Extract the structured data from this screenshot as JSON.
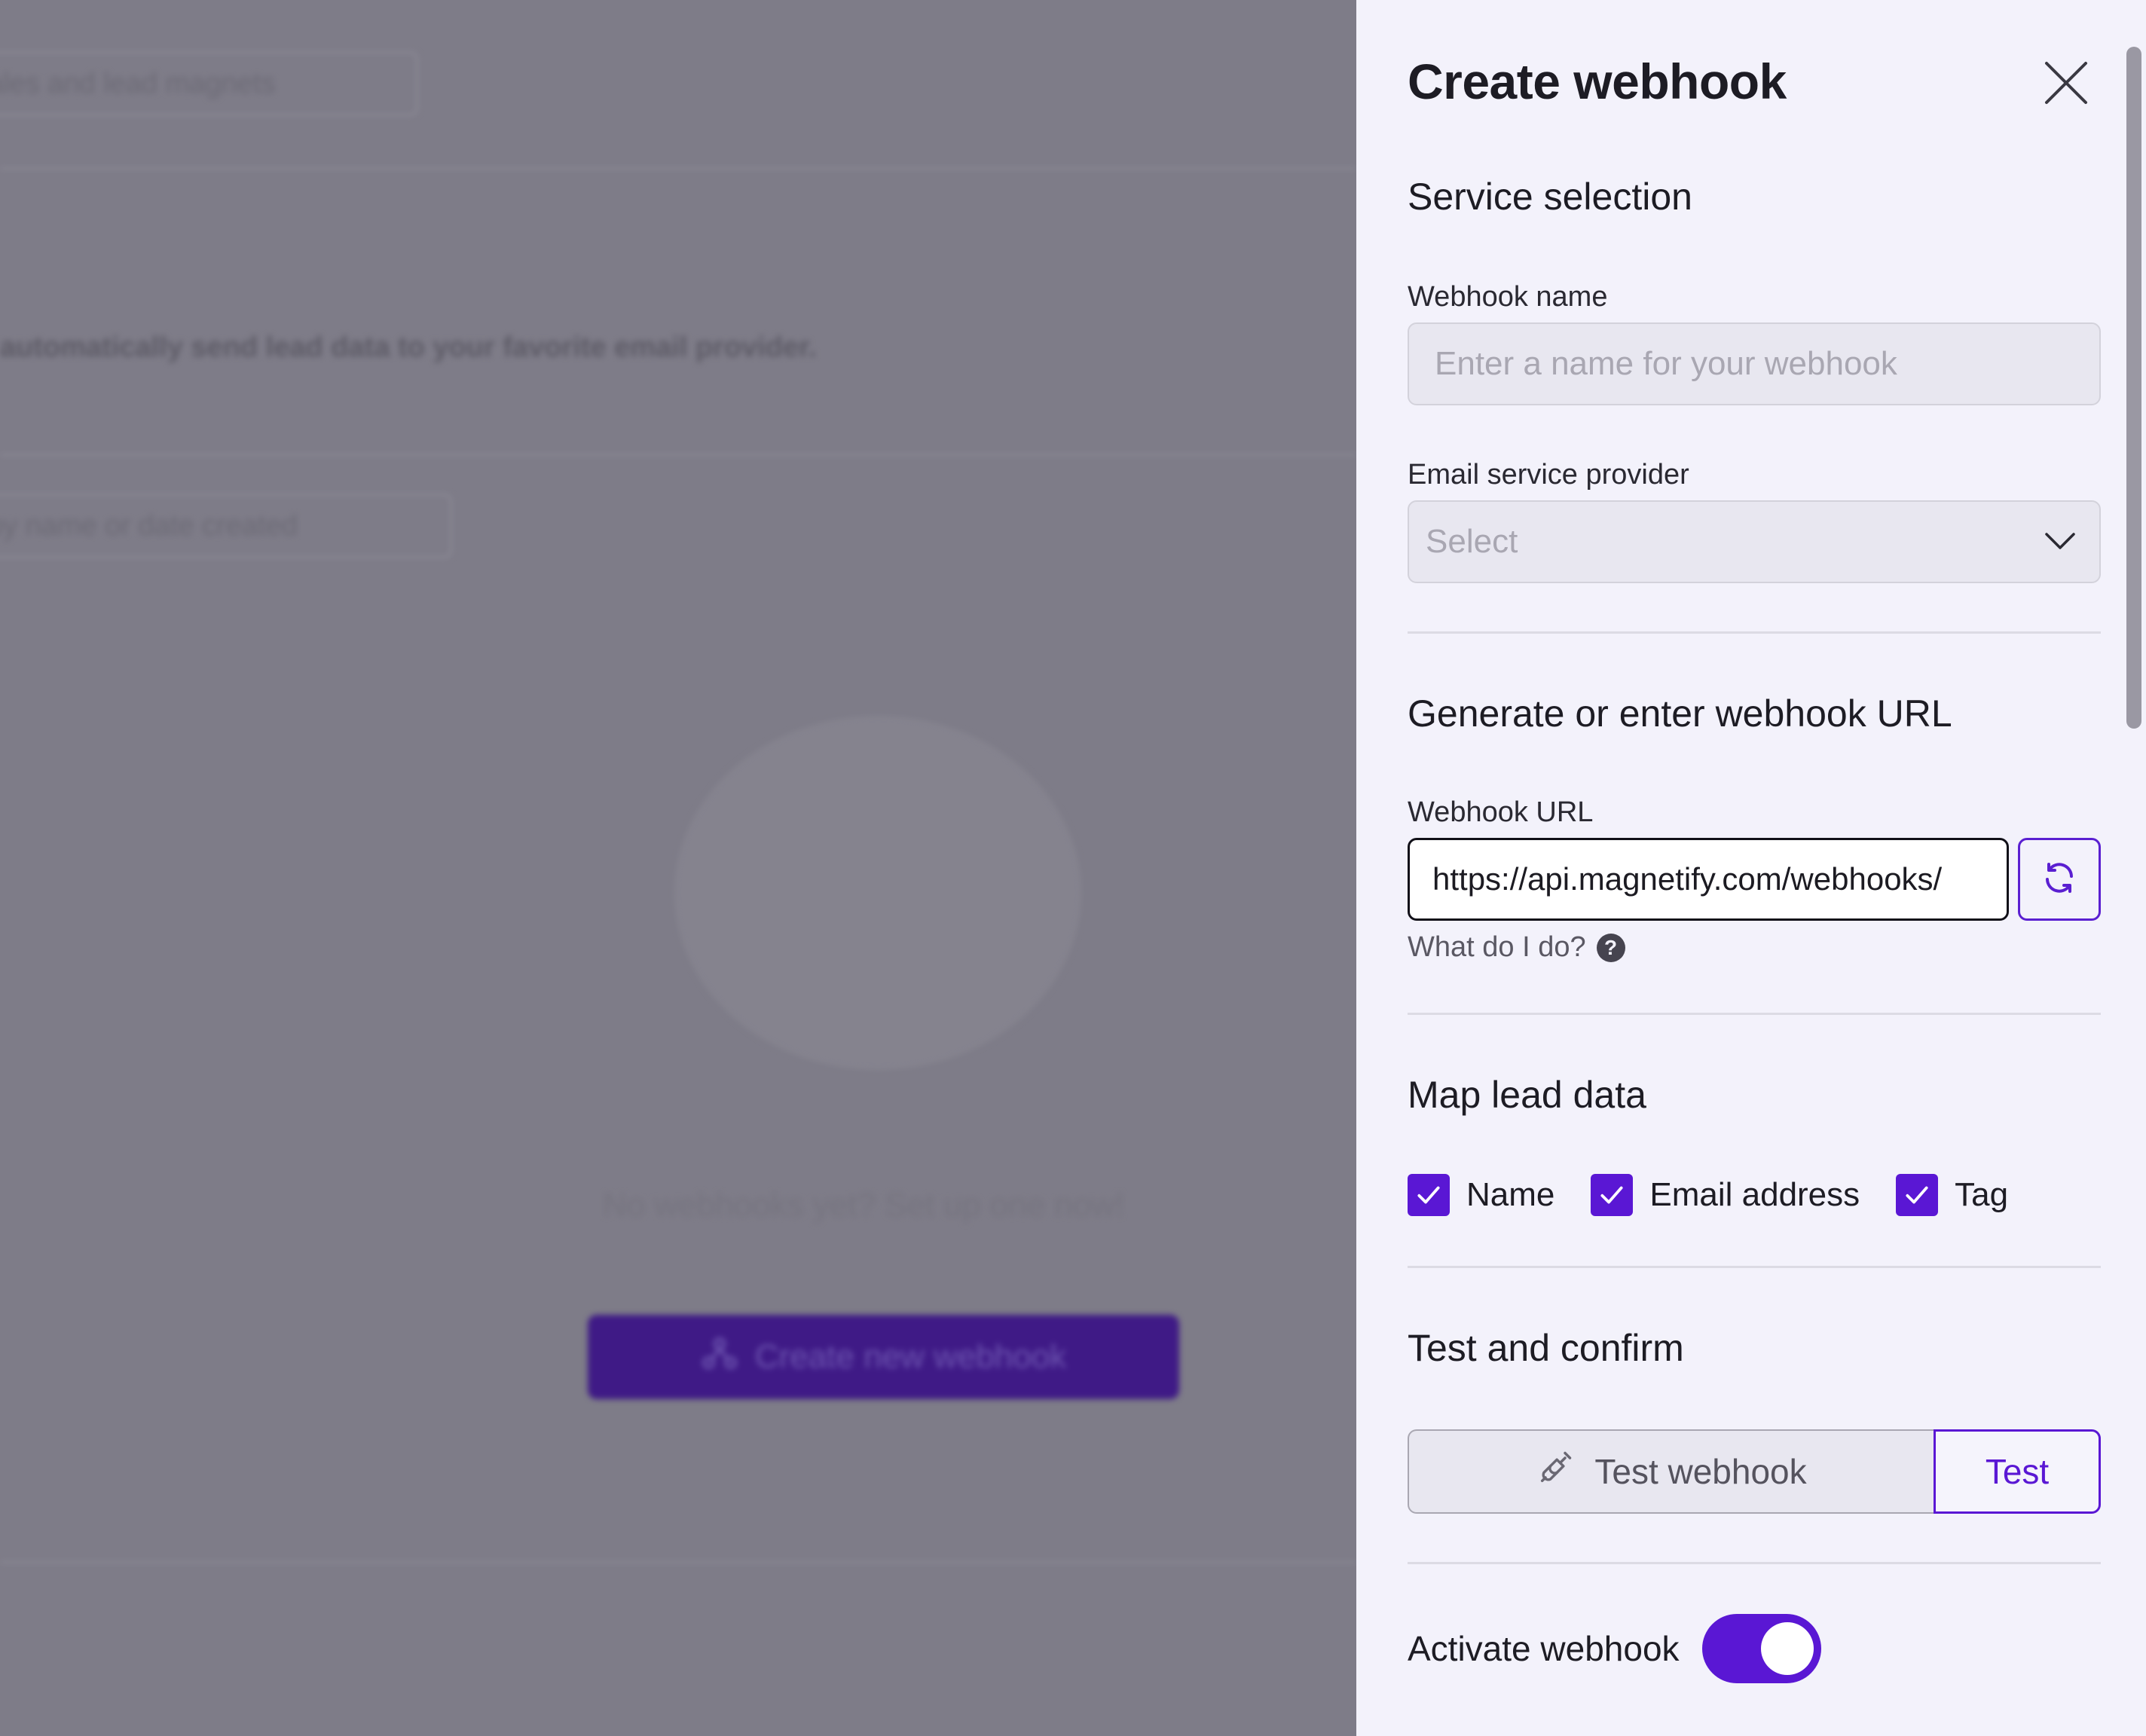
{
  "background": {
    "top_input_text": "ales and lead magnets",
    "description": "automatically send lead data to your favorite email provider.",
    "search_placeholder": "by name or date created",
    "empty_state_text": "No webhooks yet? Set up one now!",
    "create_button_label": "Create new webhook"
  },
  "drawer": {
    "title": "Create webhook",
    "service_section": {
      "heading": "Service selection",
      "name_label": "Webhook name",
      "name_placeholder": "Enter a name for your webhook",
      "provider_label": "Email service provider",
      "provider_value": "Select"
    },
    "url_section": {
      "heading": "Generate or enter webhook URL",
      "url_label": "Webhook URL",
      "url_value": "https://api.magnetify.com/webhooks/",
      "help_text": "What do I do?",
      "help_icon": "?"
    },
    "map_section": {
      "heading": "Map lead data",
      "options": [
        {
          "label": "Name",
          "checked": true
        },
        {
          "label": "Email address",
          "checked": true
        },
        {
          "label": "Tag",
          "checked": true
        }
      ]
    },
    "test_section": {
      "heading": "Test and confirm",
      "test_field_label": "Test webhook",
      "test_button": "Test"
    },
    "activate": {
      "label": "Activate webhook",
      "enabled": true
    }
  },
  "colors": {
    "accent": "#5a17d4",
    "drawer_bg": "#f3f2fb",
    "overlay": "#7e7c88"
  }
}
